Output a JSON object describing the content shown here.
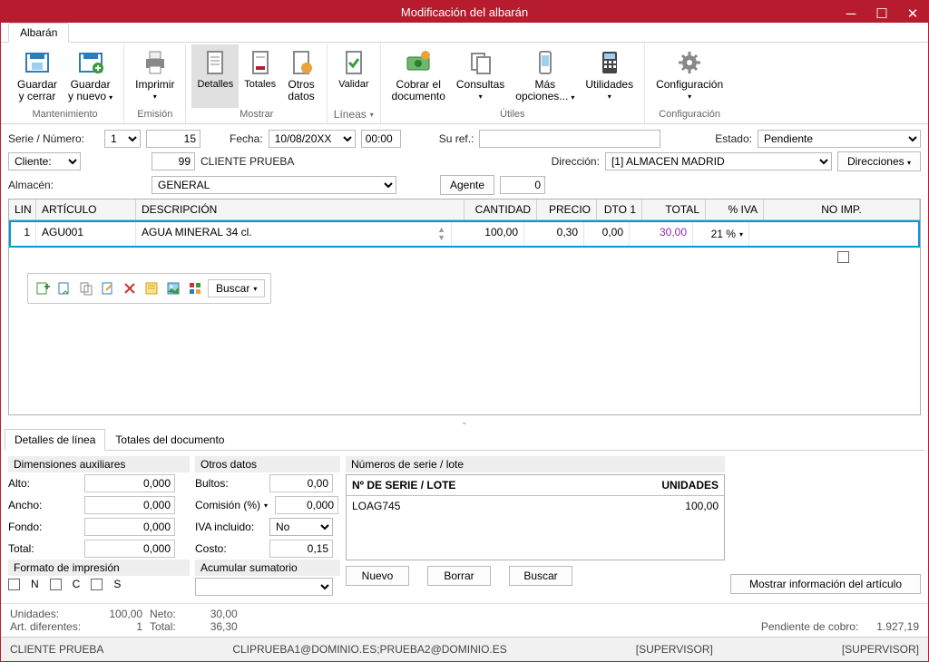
{
  "window": {
    "title": "Modificación del albarán"
  },
  "tabs": {
    "main": "Albarán"
  },
  "ribbon": {
    "guardar_cerrar": "Guardar\ny cerrar",
    "guardar_nuevo": "Guardar\ny nuevo",
    "imprimir": "Imprimir",
    "detalles": "Detalles",
    "totales": "Totales",
    "otros_datos": "Otros\ndatos",
    "validar": "Validar",
    "cobrar": "Cobrar el\ndocumento",
    "consultas": "Consultas",
    "mas_opciones": "Más\nopciones...",
    "utilidades": "Utilidades",
    "configuracion": "Configuración",
    "g_mantenimiento": "Mantenimiento",
    "g_emision": "Emisión",
    "g_mostrar": "Mostrar",
    "g_lineas": "Líneas",
    "g_utiles": "Útiles",
    "g_config": "Configuración"
  },
  "form": {
    "serie_label": "Serie / Número:",
    "serie": "1",
    "numero": "15",
    "fecha_label": "Fecha:",
    "fecha": "10/08/20XX",
    "hora": "00:00",
    "suref_label": "Su ref.:",
    "suref": "",
    "estado_label": "Estado:",
    "estado": "Pendiente",
    "cliente_label": "Cliente:",
    "cliente_code": "99",
    "cliente_name": "CLIENTE PRUEBA",
    "direccion_label": "Dirección:",
    "direccion": "[1]  ALMACEN MADRID",
    "direcciones_btn": "Direcciones",
    "almacen_label": "Almacén:",
    "almacen": "GENERAL",
    "agente_btn": "Agente",
    "agente": "0"
  },
  "grid": {
    "cols": {
      "lin": "LIN",
      "art": "ARTÍCULO",
      "desc": "DESCRIPCIÓN",
      "cant": "CANTIDAD",
      "precio": "PRECIO",
      "dto": "DTO 1",
      "total": "TOTAL",
      "iva": "% IVA",
      "noimp": "NO IMP."
    },
    "row": {
      "lin": "1",
      "art": "AGU001",
      "desc": "AGUA MINERAL 34 cl.",
      "cant": "100,00",
      "precio": "0,30",
      "dto": "0,00",
      "total": "30,00",
      "iva": "21 %"
    }
  },
  "linetoolbar": {
    "buscar": "Buscar"
  },
  "subtabs": {
    "detalles": "Detalles de línea",
    "totales": "Totales del documento"
  },
  "details": {
    "dim_head": "Dimensiones auxiliares",
    "alto": "Alto:",
    "alto_v": "0,000",
    "ancho": "Ancho:",
    "ancho_v": "0,000",
    "fondo": "Fondo:",
    "fondo_v": "0,000",
    "dtotal": "Total:",
    "dtotal_v": "0,000",
    "formato_head": "Formato de impresión",
    "fmt_n": "N",
    "fmt_c": "C",
    "fmt_s": "S",
    "otros_head": "Otros datos",
    "bultos": "Bultos:",
    "bultos_v": "0,00",
    "comision": "Comisión (%)",
    "comision_v": "0,000",
    "ivainc": "IVA incluido:",
    "ivainc_v": "No",
    "costo": "Costo:",
    "costo_v": "0,15",
    "acumular_head": "Acumular sumatorio",
    "serial_head": "Números de serie / lote",
    "serial_col1": "Nº DE SERIE / LOTE",
    "serial_col2": "UNIDADES",
    "serial_row_code": "LOAG745",
    "serial_row_units": "100,00",
    "nuevo": "Nuevo",
    "borrar": "Borrar",
    "buscar": "Buscar",
    "mostrar_info": "Mostrar información del artículo"
  },
  "summary": {
    "unidades_lbl": "Unidades:",
    "unidades": "100,00",
    "artdif_lbl": "Art. diferentes:",
    "artdif": "1",
    "neto_lbl": "Neto:",
    "neto": "30,00",
    "total_lbl": "Total:",
    "total": "36,30",
    "pendiente_lbl": "Pendiente de cobro:",
    "pendiente": "1.927,19"
  },
  "status": {
    "left": "CLIENTE PRUEBA",
    "center": "CLIPRUEBA1@DOMINIO.ES;PRUEBA2@DOMINIO.ES",
    "right1": "[SUPERVISOR]",
    "right2": "[SUPERVISOR]"
  }
}
